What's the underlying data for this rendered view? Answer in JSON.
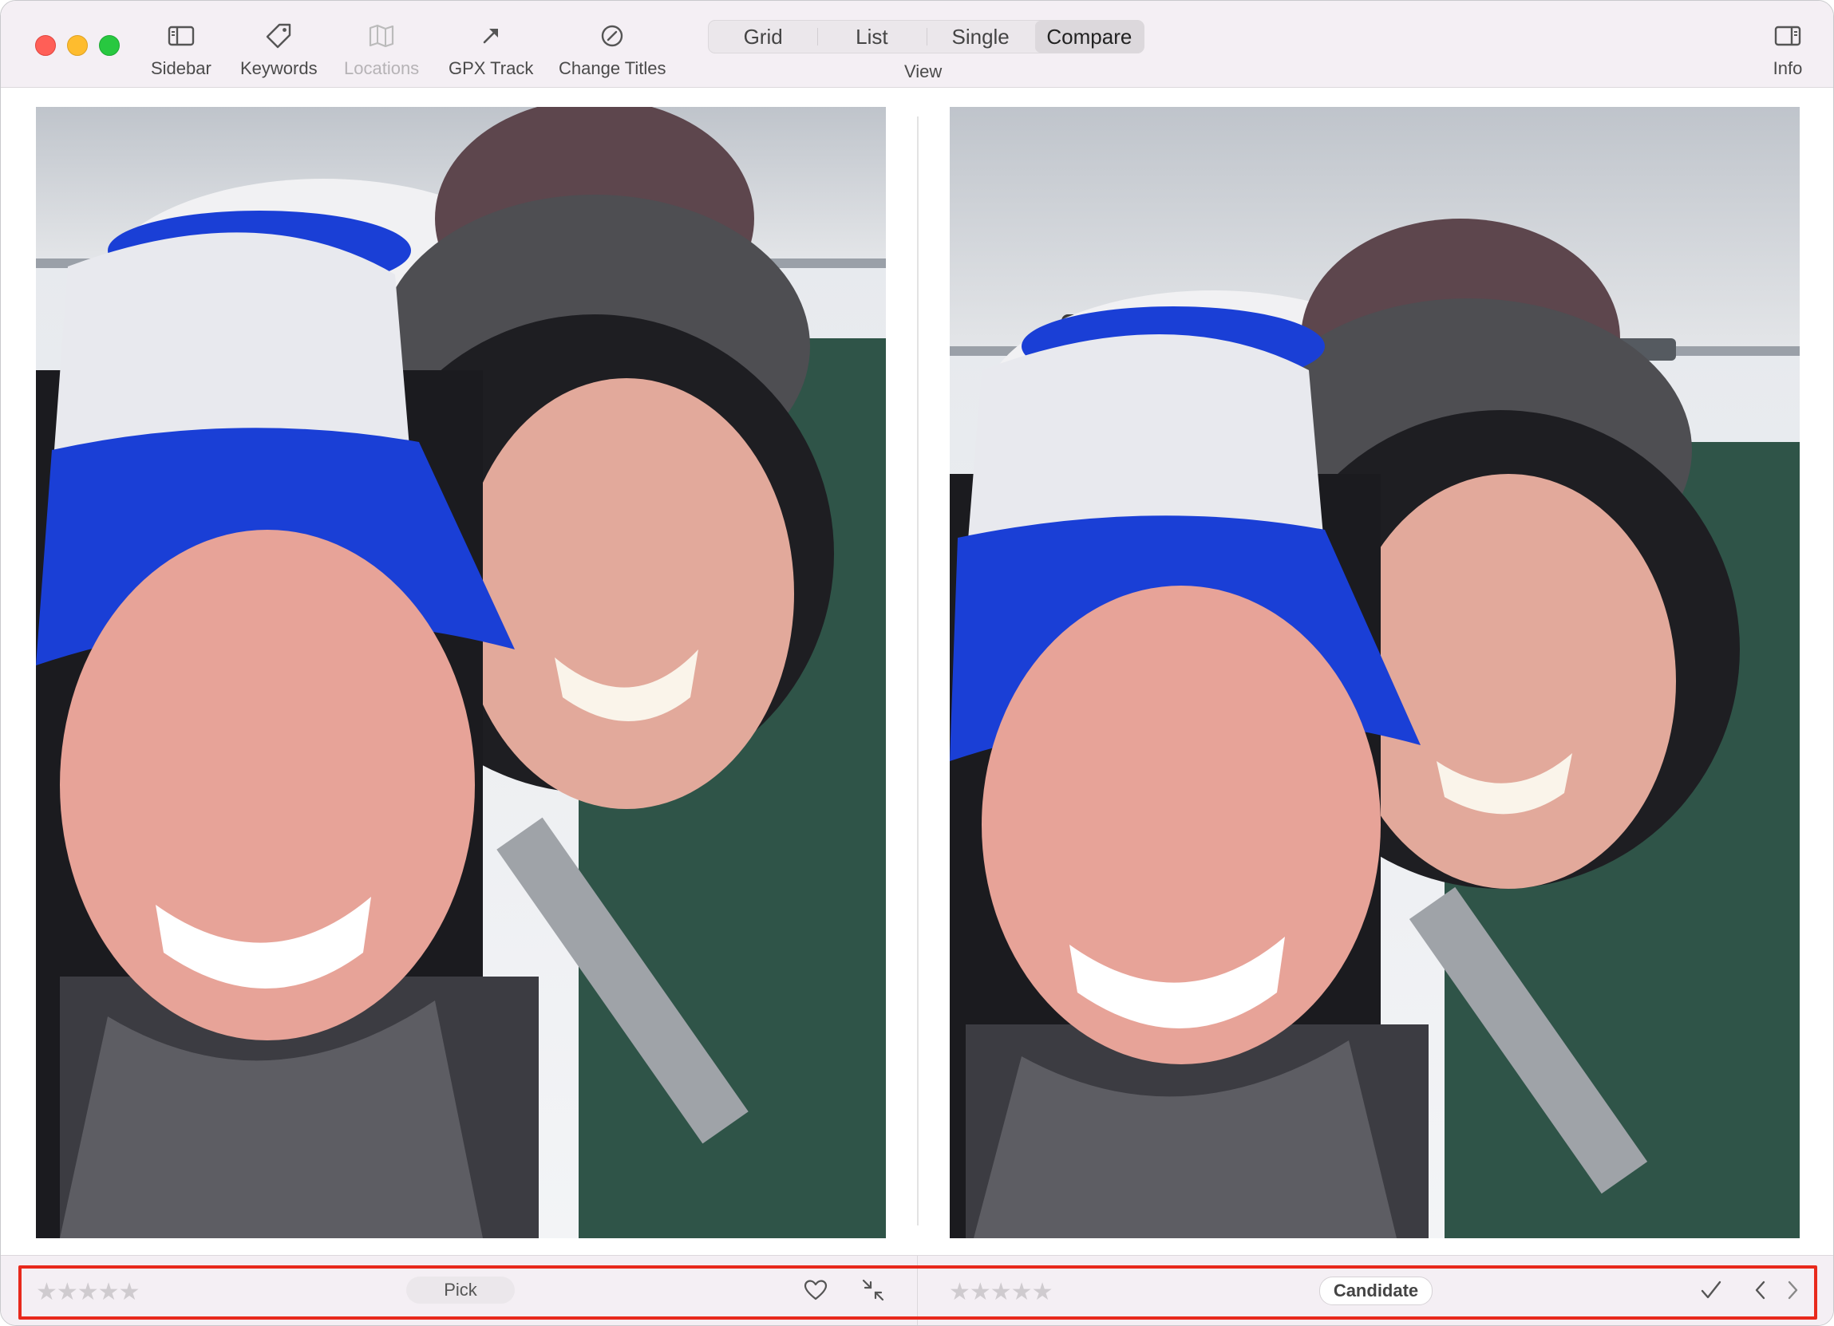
{
  "toolbar": {
    "sidebar_label": "Sidebar",
    "keywords_label": "Keywords",
    "locations_label": "Locations",
    "gpx_label": "GPX Track",
    "change_titles_label": "Change Titles",
    "view_label": "View",
    "info_label": "Info",
    "view_options": [
      "Grid",
      "List",
      "Single",
      "Compare"
    ],
    "view_selected": "Compare"
  },
  "bottom": {
    "left": {
      "rating": "★★★★★",
      "rating_value": 0,
      "status": "Pick"
    },
    "right": {
      "rating": "★★★★★",
      "rating_value": 0,
      "status": "Candidate"
    }
  },
  "colors": {
    "toolbar_bg": "#f4eff4",
    "highlight": "#e8291c",
    "hat_blue": "#1a3fd6",
    "hat_grey": "#4e4e52",
    "hat_maroon": "#7a4a55"
  },
  "icons": {
    "sidebar": "sidebar-icon",
    "keywords": "tag-icon",
    "locations": "map-icon",
    "gpx": "arrow-icon",
    "change_titles": "circle-slash-icon",
    "info": "info-panel-icon",
    "favorite": "heart-icon",
    "collapse": "collapse-icon",
    "accept": "checkmark-icon",
    "prev": "chevron-left-icon",
    "next": "chevron-right-icon"
  }
}
